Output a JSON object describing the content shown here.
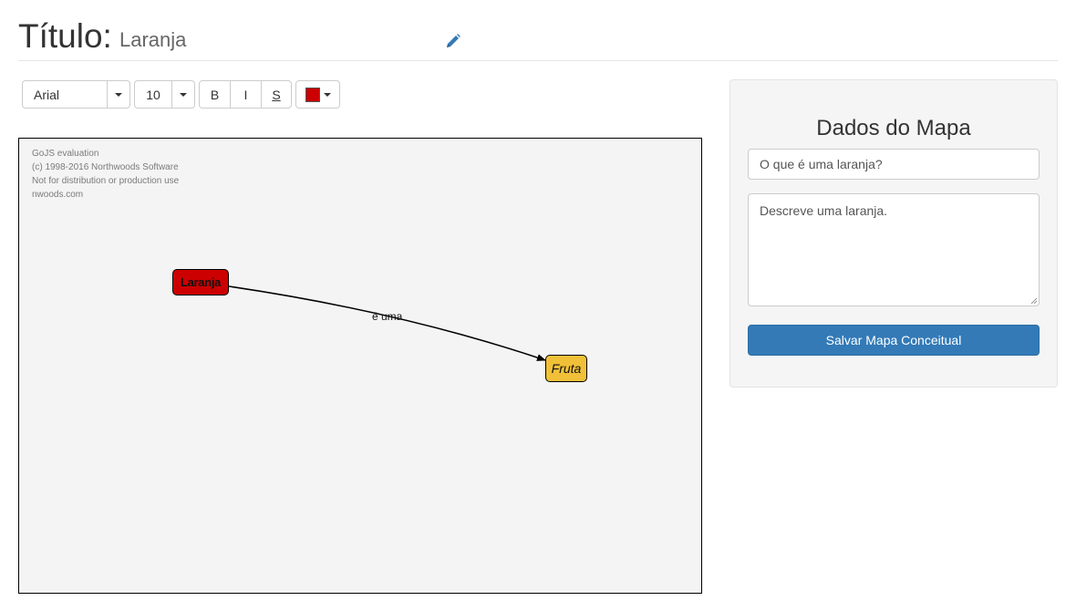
{
  "header": {
    "title_label": "Título:",
    "title_value": "Laranja",
    "edit_icon": "pencil-icon"
  },
  "toolbar": {
    "font_family": "Arial",
    "font_size": "10",
    "bold_label": "B",
    "italic_label": "I",
    "strike_label": "S",
    "selected_color": "#cc0000"
  },
  "diagram": {
    "watermark": [
      "GoJS evaluation",
      "(c) 1998-2016 Northwoods Software",
      "Not for distribution or production use",
      "nwoods.com"
    ],
    "nodes": [
      {
        "label": "Laranja",
        "color": "#cc0000",
        "bold": true
      },
      {
        "label": "Fruta",
        "color": "#f0c038",
        "italic": true
      }
    ],
    "link": {
      "label": "é uma",
      "from": "Laranja",
      "to": "Fruta"
    }
  },
  "panel": {
    "title": "Dados do Mapa",
    "question_value": "O que é uma laranja?",
    "description_value": "Descreve uma laranja.",
    "save_label": "Salvar Mapa Conceitual"
  }
}
